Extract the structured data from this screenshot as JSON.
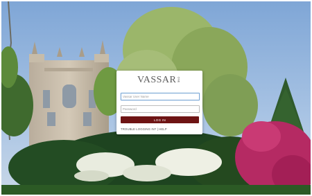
{
  "login": {
    "logo_text": "VASSAR",
    "logo_sub": "ONE",
    "username_placeholder": "Vassar User Name",
    "password_placeholder": "Password",
    "login_button": "LOG IN",
    "trouble_link": "TROUBLE LOGGING IN? | HELP"
  },
  "colors": {
    "button_bg": "#6e1414",
    "focus_border": "#7aa7d6",
    "sky": "#8fb3d9"
  }
}
